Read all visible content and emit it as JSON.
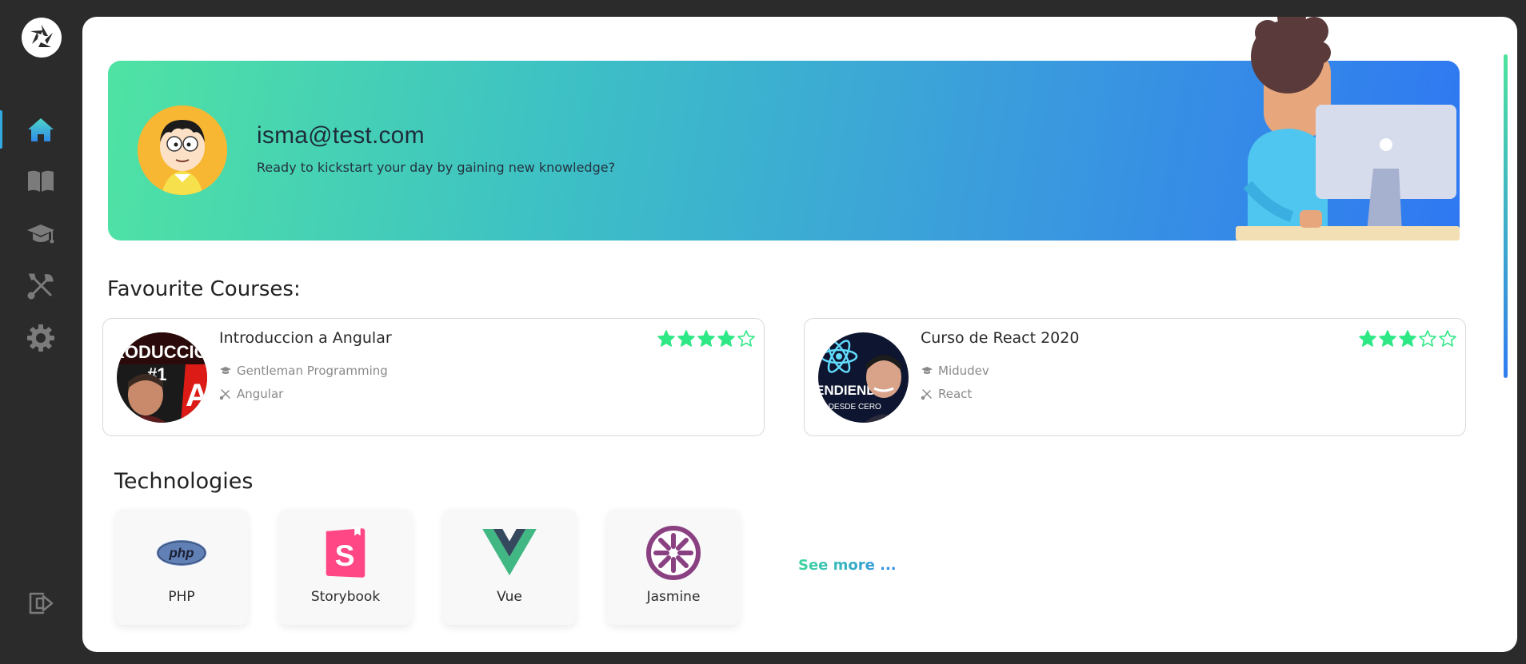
{
  "sidebar": {
    "logo_icon": "camera-aperture-icon",
    "items": [
      {
        "name": "home",
        "icon": "home-icon",
        "active": true
      },
      {
        "name": "courses",
        "icon": "book-icon",
        "active": false
      },
      {
        "name": "learning",
        "icon": "graduation-cap-icon",
        "active": false
      },
      {
        "name": "technologies",
        "icon": "tools-icon",
        "active": false
      },
      {
        "name": "settings",
        "icon": "gear-icon",
        "active": false
      }
    ],
    "logout_icon": "logout-icon"
  },
  "banner": {
    "email": "isma@test.com",
    "subtitle": "Ready to kickstart your day by gaining new knowledge?"
  },
  "favourites": {
    "title": "Favourite Courses:",
    "courses": [
      {
        "title": "Introduccion a Angular",
        "author": "Gentleman Programming",
        "technology": "Angular",
        "rating": 4,
        "max_rating": 5
      },
      {
        "title": "Curso de React 2020",
        "author": "Midudev",
        "technology": "React",
        "rating": 3,
        "max_rating": 5
      }
    ]
  },
  "technologies": {
    "title": "Technologies",
    "items": [
      {
        "label": "PHP",
        "icon": "php-logo"
      },
      {
        "label": "Storybook",
        "icon": "storybook-logo"
      },
      {
        "label": "Vue",
        "icon": "vue-logo"
      },
      {
        "label": "Jasmine",
        "icon": "jasmine-logo"
      }
    ],
    "see_more": "See more ..."
  },
  "colors": {
    "accent_green": "#2ee886",
    "accent_blue": "#34a8e0",
    "sidebar_bg": "#2b2b2b"
  }
}
